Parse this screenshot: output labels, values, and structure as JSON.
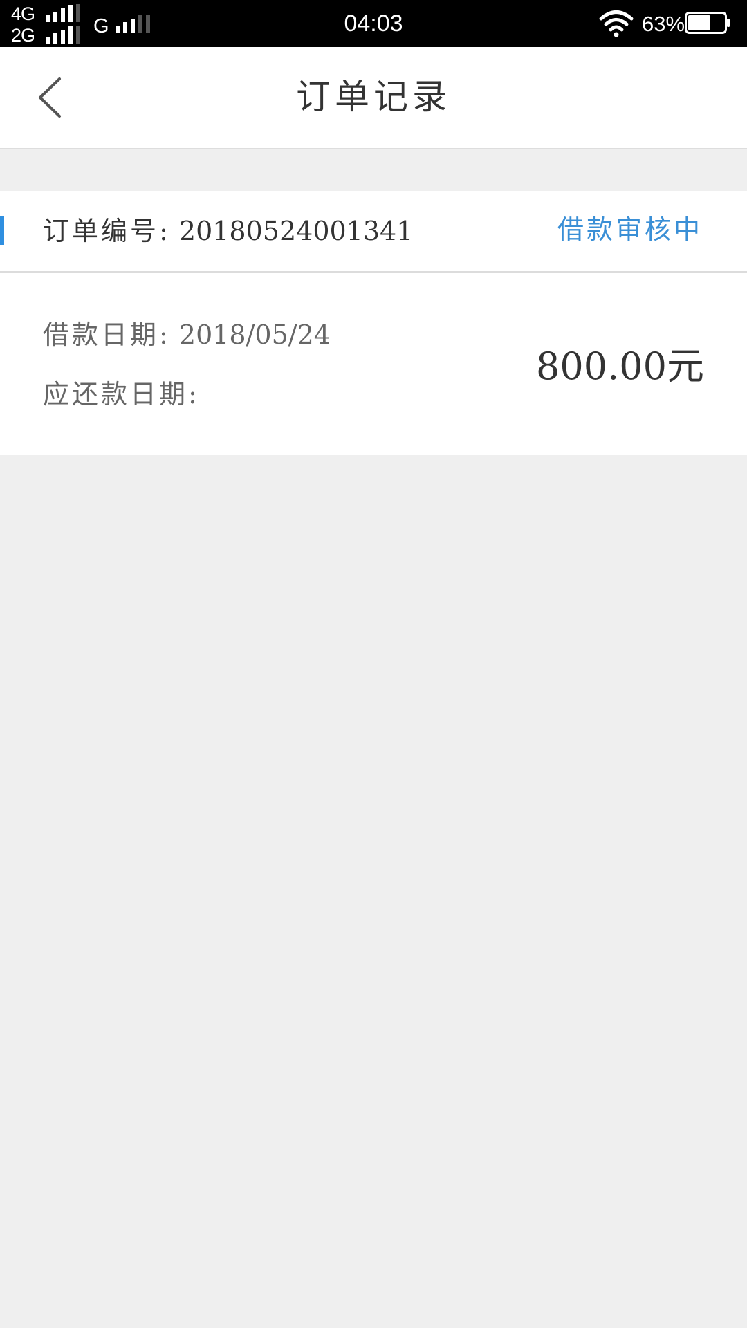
{
  "status_bar": {
    "network_1": "4G",
    "network_2": "2G",
    "network_3": "G",
    "time": "04:03",
    "battery_percent": "63%",
    "battery_level": 0.63,
    "wifi_icon": "wifi-icon",
    "signal_icon": "signal-bars-icon"
  },
  "header": {
    "back_icon": "chevron-left-icon",
    "title": "订单记录"
  },
  "order": {
    "number_label": "订单编号:",
    "number": "20180524001341",
    "status": "借款审核中",
    "status_color": "#3a8fd6",
    "loan_date_label": "借款日期:",
    "loan_date": "2018/05/24",
    "due_date_label": "应还款日期:",
    "due_date": "",
    "amount": "800.00元"
  },
  "colors": {
    "accent": "#2f8fe0",
    "background": "#efefef",
    "card": "#ffffff"
  }
}
